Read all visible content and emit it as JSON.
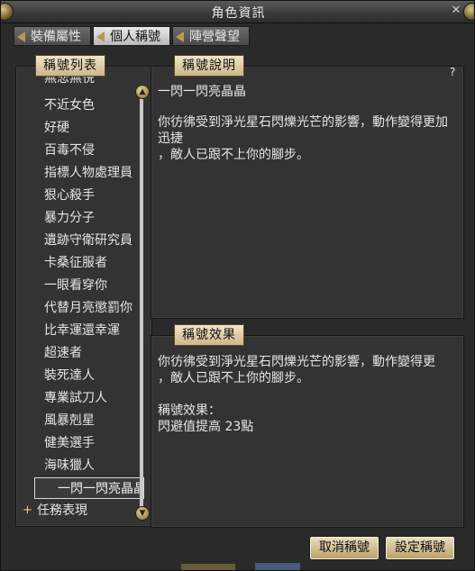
{
  "window": {
    "title": "角色資訊",
    "close_glyph": "✕"
  },
  "tabs": [
    {
      "label": "裝備屬性"
    },
    {
      "label": "個人稱號"
    },
    {
      "label": "陣營聲望"
    }
  ],
  "list": {
    "header": "稱號列表",
    "items": [
      "無悲無悦",
      "不近女色",
      "好硬",
      "百毒不侵",
      "指標人物處理員",
      "狠心殺手",
      "暴力分子",
      "遺跡守衛研究員",
      "卡桑征服者",
      "一眼看穿你",
      "代替月亮懲罰你",
      "比幸運還幸運",
      "超速者",
      "裝死達人",
      "專業試刀人",
      "風暴剋星",
      "健美選手",
      "海味獵人",
      "一閃一閃亮晶晶"
    ],
    "selected_index": 18,
    "group_label": "任務表現",
    "group_glyph": "+"
  },
  "description": {
    "header": "稱號說明",
    "help": "?",
    "title": "一閃一閃亮晶晶",
    "body": "你彷彿受到淨光星石閃爍光芒的影響，動作變得更加迅捷\n，敵人已跟不上你的腳步。"
  },
  "effect": {
    "header": "稱號效果",
    "body": "你彷彿受到淨光星石閃爍光芒的影響，動作變得更\n，敵人已跟不上你的腳步。",
    "label": "稱號效果：",
    "value": "閃避值提高 23點"
  },
  "buttons": {
    "cancel": "取消稱號",
    "set": "設定稱號"
  }
}
